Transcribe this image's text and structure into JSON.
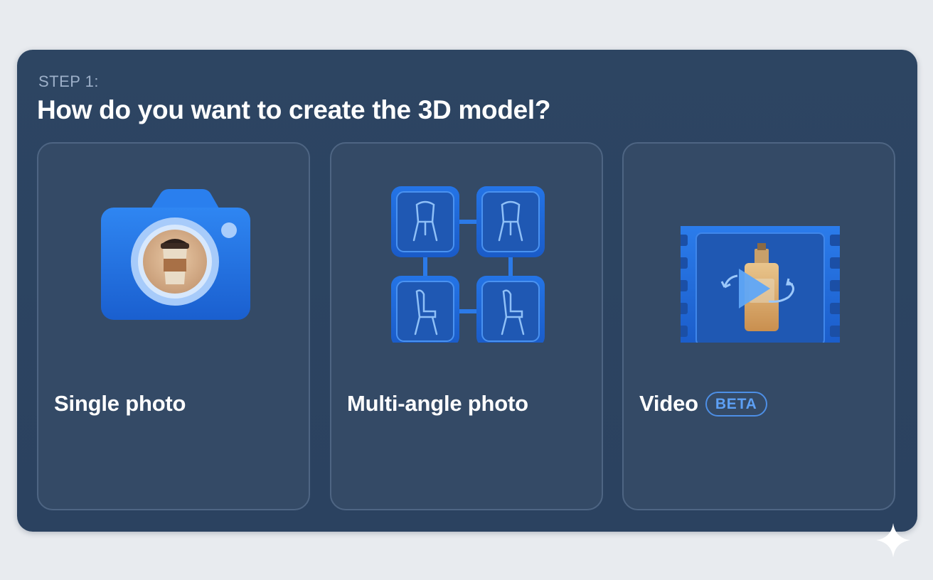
{
  "step": {
    "label": "STEP 1:",
    "title": "How do you want to create the 3D model?"
  },
  "options": [
    {
      "label": "Single photo",
      "icon": "camera-icon"
    },
    {
      "label": "Multi-angle photo",
      "icon": "multi-angle-grid-icon"
    },
    {
      "label": "Video",
      "badge": "BETA",
      "icon": "video-film-icon"
    }
  ],
  "colors": {
    "background": "#e8ebef",
    "panel": "#2d4562",
    "card": "#344a66",
    "card_border": "#4e6583",
    "accent_blue": "#1f6bd6",
    "badge_blue": "#5da0f5"
  }
}
